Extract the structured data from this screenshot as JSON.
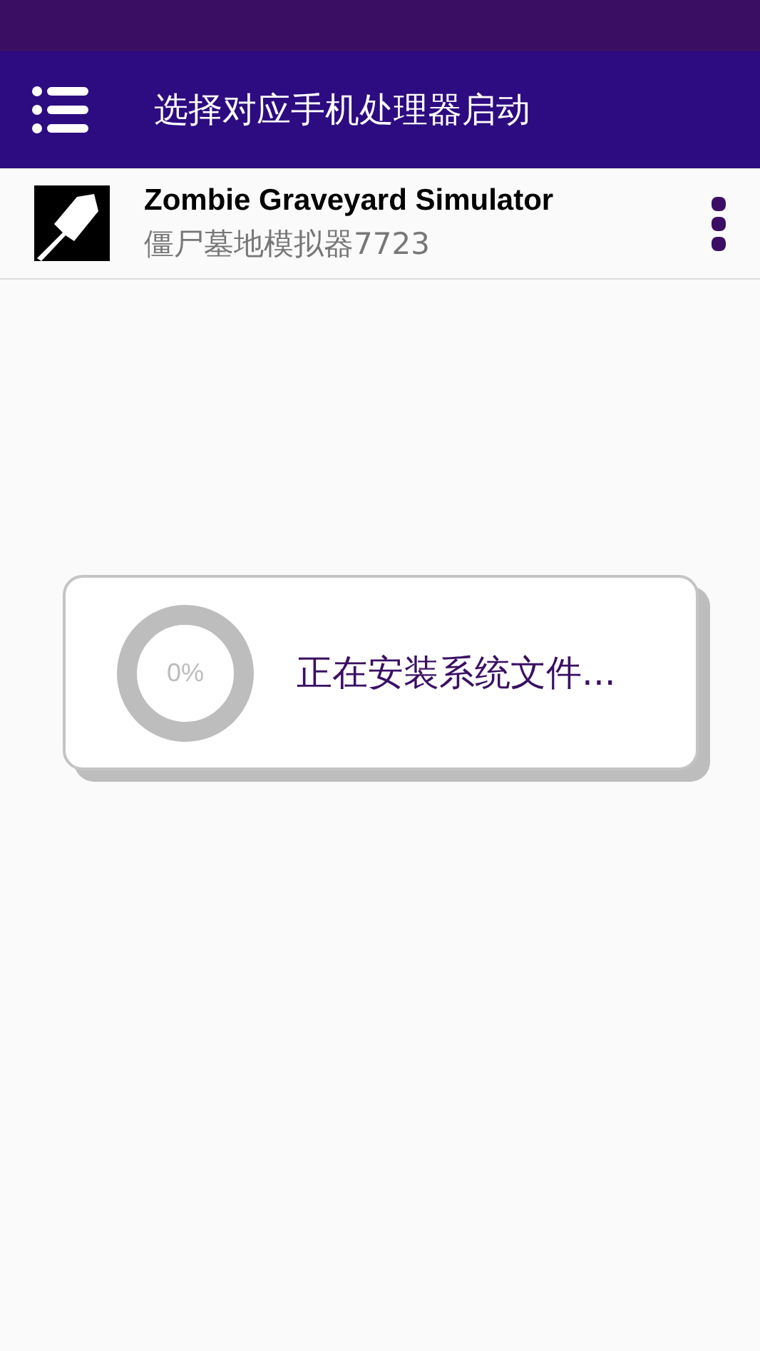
{
  "toolbar": {
    "title": "选择对应手机处理器启动"
  },
  "game": {
    "title": "Zombie Graveyard Simulator",
    "subtitle": "僵尸墓地模拟器7723"
  },
  "dialog": {
    "progress": {
      "reading": "0%"
    },
    "message": "正在安装系统文件..."
  }
}
